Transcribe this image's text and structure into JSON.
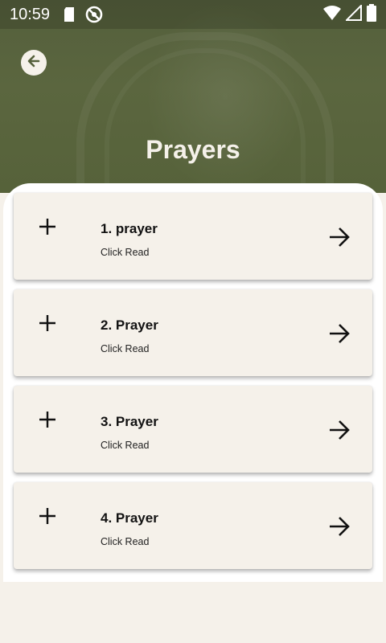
{
  "status_bar": {
    "time": "10:59",
    "icons": [
      "sd-card-icon",
      "no-sync-icon",
      "wifi-icon",
      "signal-icon",
      "battery-icon"
    ]
  },
  "header": {
    "title": "Prayers",
    "back_icon": "arrow-left-circle-icon"
  },
  "prayers": [
    {
      "title": "1. prayer",
      "subtitle": "Click Read"
    },
    {
      "title": "2. Prayer",
      "subtitle": "Click Read"
    },
    {
      "title": "3. Prayer",
      "subtitle": "Click Read"
    },
    {
      "title": "4. Prayer",
      "subtitle": "Click Read"
    }
  ],
  "colors": {
    "header_olive": "#56623a",
    "cream": "#F5F1EA",
    "text_dark": "#111111"
  }
}
